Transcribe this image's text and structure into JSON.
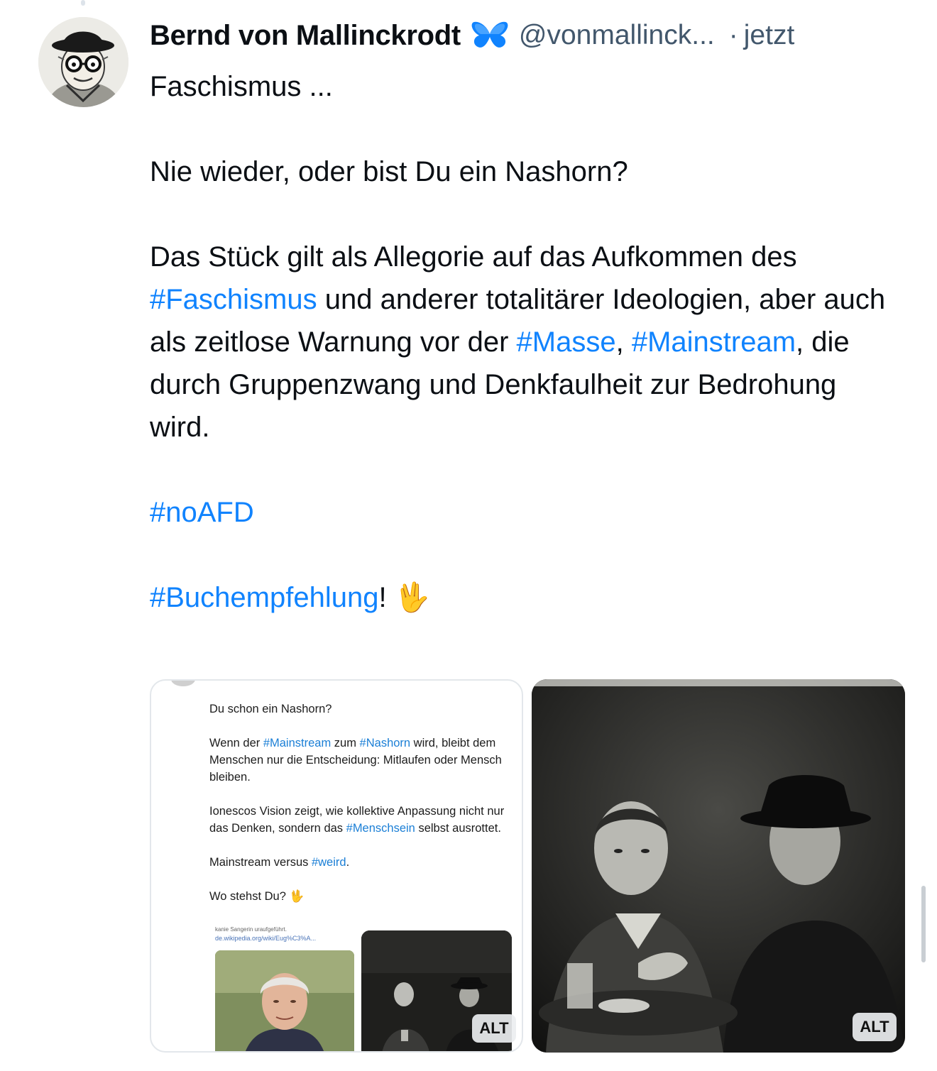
{
  "post": {
    "display_name": "Bernd von Mallinckrodt",
    "badge_icon": "butterfly-icon",
    "handle": "@vonmallinck...",
    "separator": "·",
    "time": "jetzt",
    "text": {
      "line1": "Faschismus ...",
      "line2": "Nie wieder, oder bist Du ein Nashorn?",
      "para3_a": "Das Stück gilt als Allegorie auf das Aufkommen des ",
      "tag_faschismus": "#Faschismus",
      "para3_b": " und anderer totalitärer Ideologien, aber auch als zeitlose Warnung vor der ",
      "tag_masse": "#Masse",
      "comma": ", ",
      "tag_mainstream": "#Mainstream",
      "para3_c": ", die durch Gruppenzwang und Denkfaulheit zur Bedrohung wird.",
      "tag_noafd": "#noAFD",
      "tag_buchempfehlung": "#Buchempfehlung",
      "exclaim": "!",
      "emoji": "🖖"
    }
  },
  "media": {
    "left": {
      "alt_label": "ALT",
      "inner": {
        "line1": "Du schon ein Nashorn?",
        "p2_a": "Wenn der ",
        "tag_mainstream": "#Mainstream",
        "p2_b": " zum ",
        "tag_nashorn": "#Nashorn",
        "p2_c": " wird, bleibt dem Menschen nur die Entscheidung: Mitlaufen oder Mensch bleiben.",
        "p3_a": "Ionescos Vision zeigt, wie kollektive Anpassung nicht nur das Denken, sondern das ",
        "tag_menschsein": "#Menschsein",
        "p3_b": " selbst ausrottet.",
        "p4_a": "Mainstream versus ",
        "tag_weird": "#weird",
        "p4_b": ".",
        "p5": "Wo stehst Du? 🖖",
        "caption": "kanie Sangerin uraufgeführt.",
        "link": "de.wikipedia.org/wiki/Eug%C3%A..."
      }
    },
    "right": {
      "alt_label": "ALT"
    }
  }
}
